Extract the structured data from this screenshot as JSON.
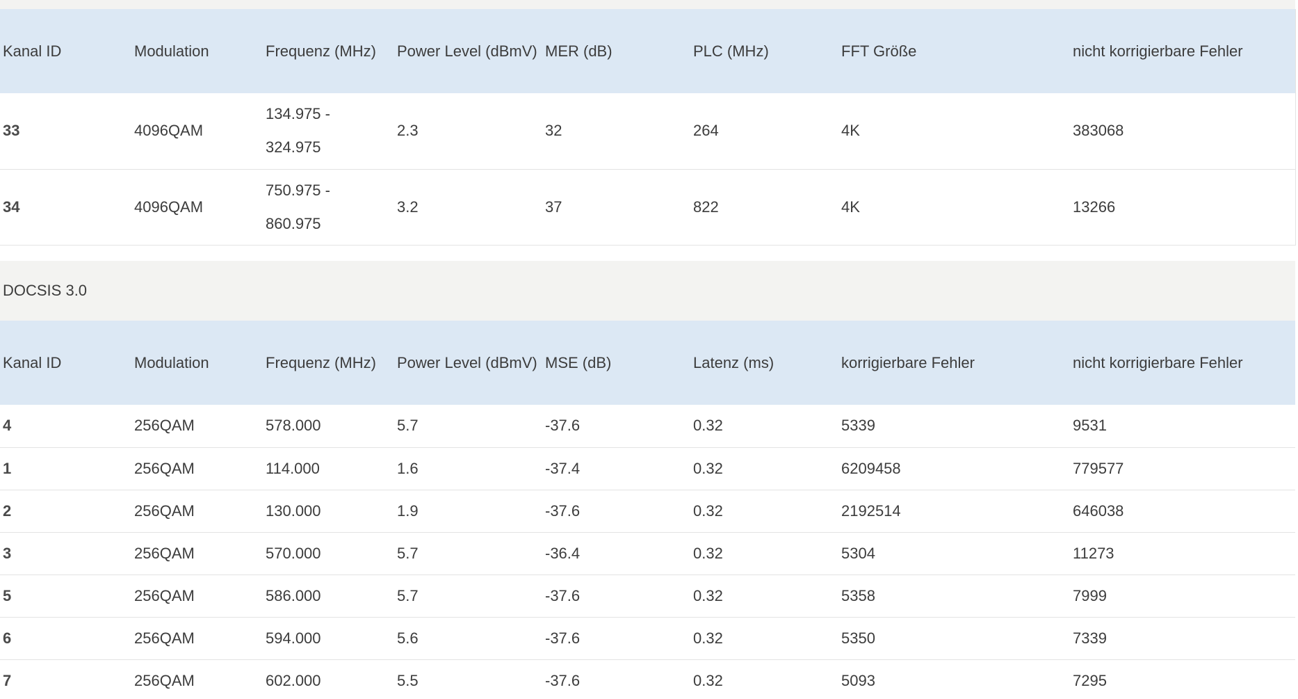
{
  "docsis31": {
    "headers": [
      "Kanal ID",
      "Modulation",
      "Frequenz (MHz)",
      "Power Level (dBmV)",
      "MER (dB)",
      "PLC (MHz)",
      "FFT Größe",
      "nicht korrigierbare Fehler"
    ],
    "rows": [
      {
        "kanal_id": "33",
        "modulation": "4096QAM",
        "freq_line1": "134.975 -",
        "freq_line2": "324.975",
        "power": "2.3",
        "mer": "32",
        "plc": "264",
        "fft": "4K",
        "nicht_korr": "383068"
      },
      {
        "kanal_id": "34",
        "modulation": "4096QAM",
        "freq_line1": "750.975 -",
        "freq_line2": "860.975",
        "power": "3.2",
        "mer": "37",
        "plc": "822",
        "fft": "4K",
        "nicht_korr": "13266"
      }
    ]
  },
  "docsis30": {
    "section_title": "DOCSIS 3.0",
    "headers": [
      "Kanal ID",
      "Modulation",
      "Frequenz (MHz)",
      "Power Level (dBmV)",
      "MSE (dB)",
      "Latenz (ms)",
      "korrigierbare Fehler",
      "nicht korrigierbare Fehler"
    ],
    "rows": [
      {
        "kanal_id": "4",
        "modulation": "256QAM",
        "freq": "578.000",
        "power": "5.7",
        "mse": "-37.6",
        "latenz": "0.32",
        "korr": "5339",
        "nicht_korr": "9531"
      },
      {
        "kanal_id": "1",
        "modulation": "256QAM",
        "freq": "114.000",
        "power": "1.6",
        "mse": "-37.4",
        "latenz": "0.32",
        "korr": "6209458",
        "nicht_korr": "779577"
      },
      {
        "kanal_id": "2",
        "modulation": "256QAM",
        "freq": "130.000",
        "power": "1.9",
        "mse": "-37.6",
        "latenz": "0.32",
        "korr": "2192514",
        "nicht_korr": "646038"
      },
      {
        "kanal_id": "3",
        "modulation": "256QAM",
        "freq": "570.000",
        "power": "5.7",
        "mse": "-36.4",
        "latenz": "0.32",
        "korr": "5304",
        "nicht_korr": "11273"
      },
      {
        "kanal_id": "5",
        "modulation": "256QAM",
        "freq": "586.000",
        "power": "5.7",
        "mse": "-37.6",
        "latenz": "0.32",
        "korr": "5358",
        "nicht_korr": "7999"
      },
      {
        "kanal_id": "6",
        "modulation": "256QAM",
        "freq": "594.000",
        "power": "5.6",
        "mse": "-37.6",
        "latenz": "0.32",
        "korr": "5350",
        "nicht_korr": "7339"
      },
      {
        "kanal_id": "7",
        "modulation": "256QAM",
        "freq": "602.000",
        "power": "5.5",
        "mse": "-37.6",
        "latenz": "0.32",
        "korr": "5093",
        "nicht_korr": "7295"
      }
    ]
  }
}
